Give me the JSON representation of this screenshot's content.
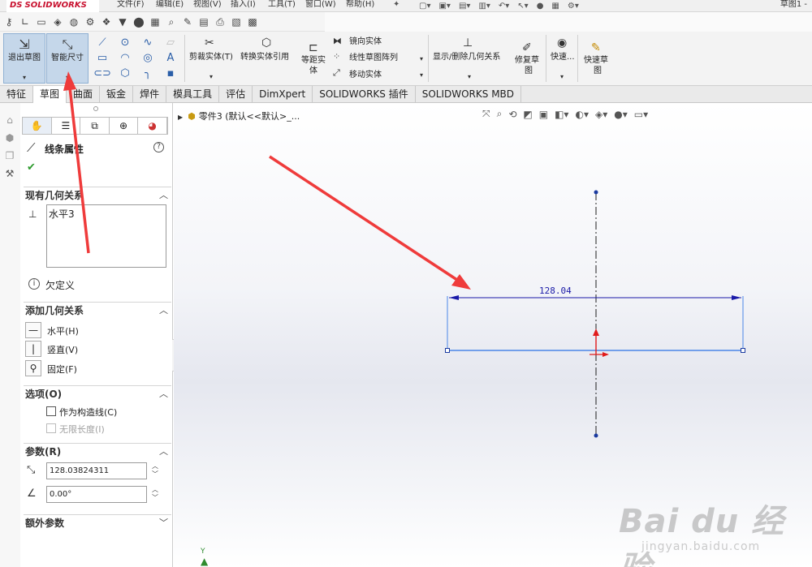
{
  "app": {
    "logo_ds": "DS",
    "logo_name": "SOLIDWORKS",
    "doc_title": "草图1 -"
  },
  "menus": [
    "文件(F)",
    "编辑(E)",
    "视图(V)",
    "插入(I)",
    "工具(T)",
    "窗口(W)",
    "帮助(H)"
  ],
  "ribbon": {
    "exit_sketch": "退出草图",
    "smart_dimension": "智能尺寸",
    "trim_entities": "剪裁实体(T)",
    "convert_entities": "转换实体引用",
    "offset_line1": "等距实",
    "offset_line2": "体",
    "mirror_entities": "镜向实体",
    "linear_pattern": "线性草图阵列",
    "move_entities": "移动实体",
    "show_relations": "显示/删除几何关系",
    "repair_line1": "修复草",
    "repair_line2": "图",
    "quick_snaps": "快速...",
    "rapid_line1": "快速草",
    "rapid_line2": "图"
  },
  "tabs": [
    "特征",
    "草图",
    "曲面",
    "钣金",
    "焊件",
    "模具工具",
    "评估",
    "DimXpert",
    "SOLIDWORKS 插件",
    "SOLIDWORKS MBD"
  ],
  "active_tab": "草图",
  "panel": {
    "title": "线条属性",
    "existing_relations": {
      "header": "现有几何关系",
      "items": [
        "水平3"
      ]
    },
    "status": "欠定义",
    "add_relations": {
      "header": "添加几何关系",
      "horizontal": "水平(H)",
      "vertical": "竖直(V)",
      "fix": "固定(F)"
    },
    "options": {
      "header": "选项(O)",
      "construction": "作为构造线(C)",
      "infinite_length": "无限长度(I)"
    },
    "parameters": {
      "header": "参数(R)",
      "length": "128.03824311",
      "angle": "0.00°"
    },
    "extra_parameters": "额外参数"
  },
  "viewport": {
    "tree_node": "零件3 (默认<<默认>_...",
    "triad_axis": "Y"
  },
  "sketch": {
    "dimension_text": "128.04",
    "colors": {
      "line": "#4a86e8",
      "dimension": "#1a1aa8",
      "centerline": "#1f1f1f",
      "point": "#1a3aa0",
      "origin": "#e01b1b",
      "annotation_arrow": "#ef3b3b"
    }
  },
  "watermark": {
    "main": "Bai du 经验",
    "sub": "jingyan.baidu.com"
  }
}
